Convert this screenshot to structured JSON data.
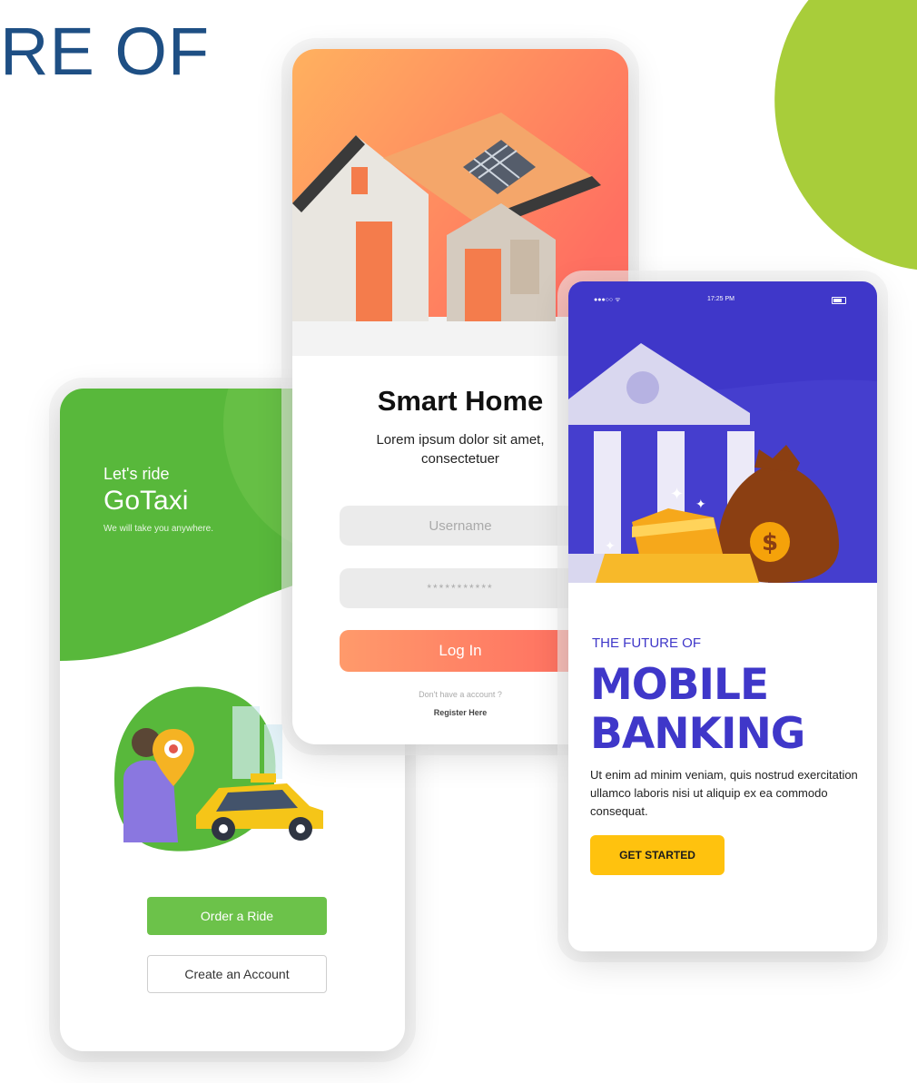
{
  "slide": {
    "title": "RE OF"
  },
  "colors": {
    "green": "#6cc24a",
    "green_dark": "#58b83b",
    "lime": "#a8cd3a",
    "orange": "#ff8a5b",
    "indigo": "#3f37c9",
    "yellow": "#ffc20e",
    "title_blue": "#1e4f84"
  },
  "taxi": {
    "subtitle": "Let's ride",
    "brand": "GoTaxi",
    "tagline": "We will take you anywhere.",
    "order_button": "Order a Ride",
    "create_button": "Create an Account"
  },
  "home": {
    "title": "Smart Home",
    "description": "Lorem ipsum dolor sit amet, consectetuer",
    "username_placeholder": "Username",
    "password_value": "***********",
    "login_button": "Log In",
    "no_account": "Don't have a account ?",
    "register": "Register Here"
  },
  "bank": {
    "status_signal": "●●●○○ ᯤ",
    "status_time": "17:25 PM",
    "kicker": "THE FUTURE OF",
    "headline_1": "MOBILE",
    "headline_2": "BANKING",
    "description": "Ut enim ad minim veniam, quis nostrud exercitation ullamco laboris nisi ut aliquip ex ea commodo consequat.",
    "cta": "GET STARTED"
  }
}
